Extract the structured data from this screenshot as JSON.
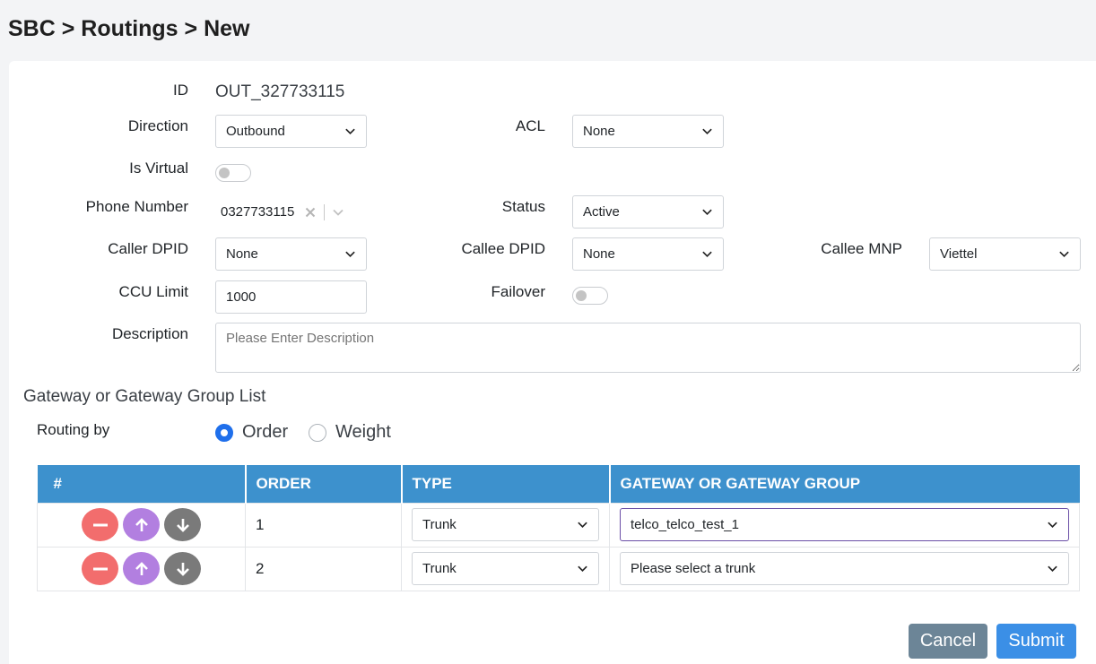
{
  "breadcrumb": "SBC > Routings > New",
  "form": {
    "id_label": "ID",
    "id_value": "OUT_327733115",
    "direction_label": "Direction",
    "direction_value": "Outbound",
    "acl_label": "ACL",
    "acl_value": "None",
    "is_virtual_label": "Is Virtual",
    "phone_label": "Phone Number",
    "phone_value": "0327733115",
    "status_label": "Status",
    "status_value": "Active",
    "caller_dpid_label": "Caller DPID",
    "caller_dpid_value": "None",
    "callee_dpid_label": "Callee DPID",
    "callee_dpid_value": "None",
    "callee_mnp_label": "Callee MNP",
    "callee_mnp_value": "Viettel",
    "ccu_label": "CCU Limit",
    "ccu_value": "1000",
    "failover_label": "Failover",
    "description_label": "Description",
    "description_placeholder": "Please Enter Description"
  },
  "gateway": {
    "section_title": "Gateway or Gateway Group List",
    "routing_label": "Routing by",
    "option_order": "Order",
    "option_weight": "Weight",
    "selected": "Order",
    "headers": [
      "#",
      "ORDER",
      "TYPE",
      "GATEWAY OR GATEWAY GROUP"
    ],
    "rows": [
      {
        "order": "1",
        "type": "Trunk",
        "gateway": "telco_telco_test_1"
      },
      {
        "order": "2",
        "type": "Trunk",
        "gateway": "Please select a trunk"
      }
    ]
  },
  "actions": {
    "cancel": "Cancel",
    "submit": "Submit"
  },
  "colors": {
    "header_bg": "#3d91cd",
    "remove": "#f26d6d",
    "move_up": "#b27fe0",
    "move_down": "#7a7a7a",
    "cancel": "#6c8597",
    "submit": "#3b8fe6"
  }
}
